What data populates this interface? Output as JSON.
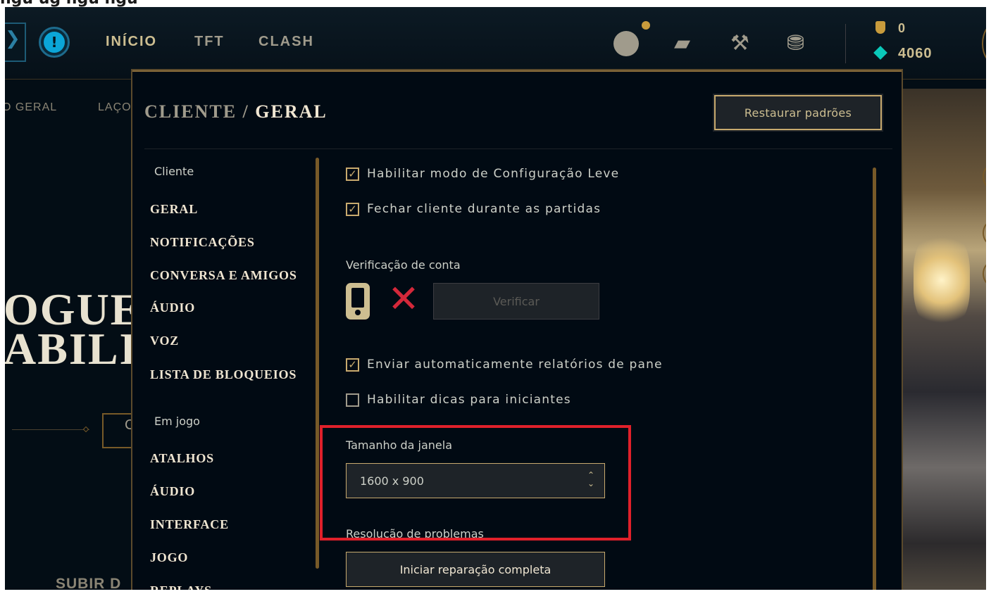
{
  "caption": {
    "text": "ngu ug ngu ngu"
  },
  "nav": {
    "items": [
      "INÍCIO",
      "TFT",
      "CLASH"
    ],
    "rp_value": "0",
    "be_value": "4060",
    "icons": {
      "alert": "alert-icon",
      "profile": "profile-icon",
      "bag": "bag-icon",
      "craft": "crafting-icon",
      "coins": "coins-icon",
      "rp": "riot-points-icon",
      "be": "blue-essence-icon"
    },
    "alert_glyph": "!",
    "left_glyph": "❯",
    "bag_glyph": "▰",
    "craft_glyph": "⚒",
    "coins_glyph": "⛃"
  },
  "background": {
    "tabs": [
      "O GERAL",
      "LAÇO"
    ],
    "heading_1": "OGUE",
    "heading_2": "ABILIT",
    "button_text": "C",
    "footer_text": "SUBIR D"
  },
  "modal": {
    "title_section": "CLIENTE",
    "title_separator": "/",
    "title_current": "GERAL",
    "restore_label": "Restaurar padrões"
  },
  "sidebar": {
    "group_client": "Cliente",
    "client_items": [
      "GERAL",
      "NOTIFICAÇÕES",
      "CONVERSA E AMIGOS",
      "ÁUDIO",
      "VOZ",
      "LISTA DE BLOQUEIOS"
    ],
    "group_ingame": "Em jogo",
    "ingame_items": [
      "ATALHOS",
      "ÁUDIO",
      "INTERFACE",
      "JOGO",
      "REPLAYS"
    ]
  },
  "settings": {
    "checks": [
      {
        "label": "Habilitar modo de Configuração Leve",
        "checked": true,
        "mark": "✓"
      },
      {
        "label": "Fechar cliente durante as partidas",
        "checked": true,
        "mark": "✓"
      },
      {
        "label": "Enviar automaticamente relatórios de pane",
        "checked": true,
        "mark": "✓"
      },
      {
        "label": "Habilitar dicas para iniciantes",
        "checked": false,
        "mark": ""
      }
    ],
    "account_verification_label": "Verificação de conta",
    "verify_button": "Verificar",
    "x_glyph": "✕",
    "window_size_label": "Tamanho da janela",
    "window_size_value": "1600 x 900",
    "troubleshoot_label": "Resolução de problemas",
    "repair_button": "Iniciar reparação completa"
  },
  "colors": {
    "gold": "#c8aa6e",
    "dark_bg": "#010a13",
    "highlight_red": "#e0202a",
    "error_red": "#d4283a"
  }
}
